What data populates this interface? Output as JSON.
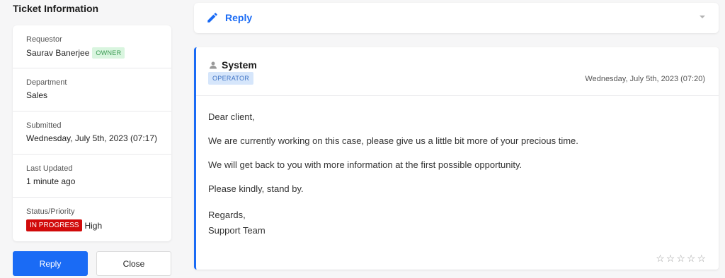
{
  "sidebar": {
    "title": "Ticket Information",
    "rows": [
      {
        "label": "Requestor",
        "value": "Saurav Banerjee",
        "badge": "OWNER"
      },
      {
        "label": "Department",
        "value": "Sales"
      },
      {
        "label": "Submitted",
        "value": "Wednesday, July 5th, 2023 (07:17)"
      },
      {
        "label": "Last Updated",
        "value": "1 minute ago"
      },
      {
        "label": "Status/Priority",
        "status": "IN PROGRESS",
        "value": "High"
      }
    ],
    "reply_button": "Reply",
    "close_button": "Close"
  },
  "reply_bar": {
    "label": "Reply",
    "icon": "pencil-icon",
    "toggle_icon": "caret-down-icon"
  },
  "message": {
    "author": "System",
    "role": "OPERATOR",
    "date": "Wednesday, July 5th, 2023 (07:20)",
    "paragraphs": [
      "Dear client,",
      "We are currently working on this case, please give us a little bit more of your precious time.",
      "We will get back to you with more information at the first possible opportunity.",
      "Please kindly, stand by."
    ],
    "closing": [
      "Regards,",
      "Support Team"
    ],
    "rating": {
      "value": 0,
      "max": 5
    }
  },
  "colors": {
    "accent": "#1a6bf5",
    "status_red": "#d10a0a",
    "owner_green": "#3a9a52",
    "operator_blue": "#3f73c4"
  }
}
